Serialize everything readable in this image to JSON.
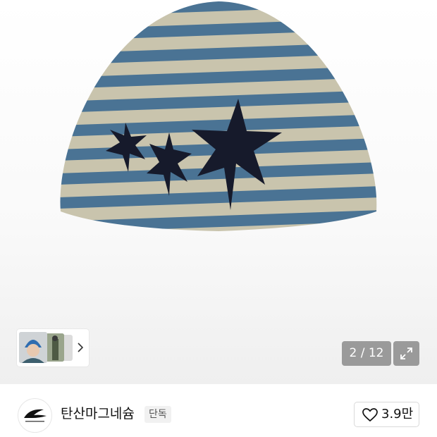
{
  "gallery": {
    "current": "2",
    "total": "12",
    "separator": "/",
    "thumbnail_strip_icon": "chevron-right-icon",
    "expand_icon": "expand-icon"
  },
  "shop": {
    "name": "탄산마그네슘",
    "badge": "단독",
    "logo_icon": "brand-logo-icon",
    "like_icon": "heart-icon",
    "like_count": "3.9만"
  },
  "colors": {
    "stripe_blue": "#4a7394",
    "stripe_beige": "#c9c4ad",
    "star_navy": "#161a2b",
    "overlay_gray": "#7a7a7a"
  }
}
